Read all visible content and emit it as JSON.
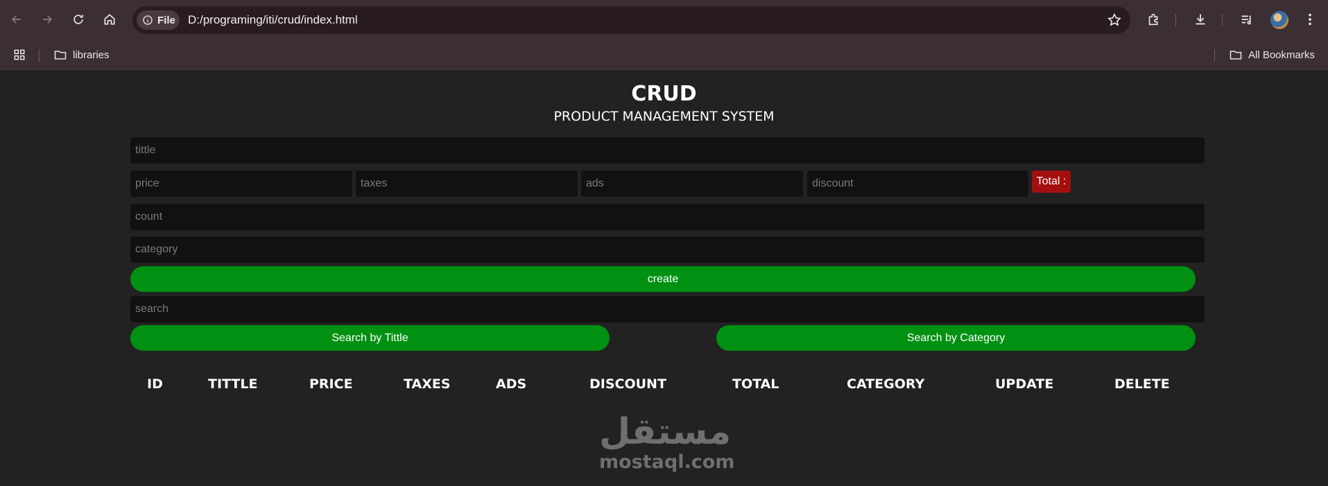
{
  "browser": {
    "file_chip": "File",
    "url": "D:/programing/iti/crud/index.html",
    "bookmarks": [
      {
        "label": "libraries"
      },
      {
        "label": "All Bookmarks"
      }
    ]
  },
  "header": {
    "title": "CRUD",
    "subtitle": "PRODUCT MANAGEMENT SYSTEM"
  },
  "form": {
    "title_placeholder": "tittle",
    "price_placeholder": "price",
    "taxes_placeholder": "taxes",
    "ads_placeholder": "ads",
    "discount_placeholder": "discount",
    "total_label": "Total :",
    "count_placeholder": "count",
    "category_placeholder": "category",
    "create_label": "create",
    "search_placeholder": "search",
    "search_title_label": "Search by Tittle",
    "search_category_label": "Search by Category"
  },
  "table": {
    "headers": [
      "ID",
      "TITTLE",
      "PRICE",
      "TAXES",
      "ADS",
      "DISCOUNT",
      "TOTAL",
      "CATEGORY",
      "UPDATE",
      "DELETE"
    ]
  },
  "watermark": {
    "arabic": "مستقل",
    "latin": "mostaql.com"
  },
  "colors": {
    "page_bg": "#222222",
    "field_bg": "#111111",
    "button_green": "#009112",
    "total_red": "#a30f0f"
  }
}
